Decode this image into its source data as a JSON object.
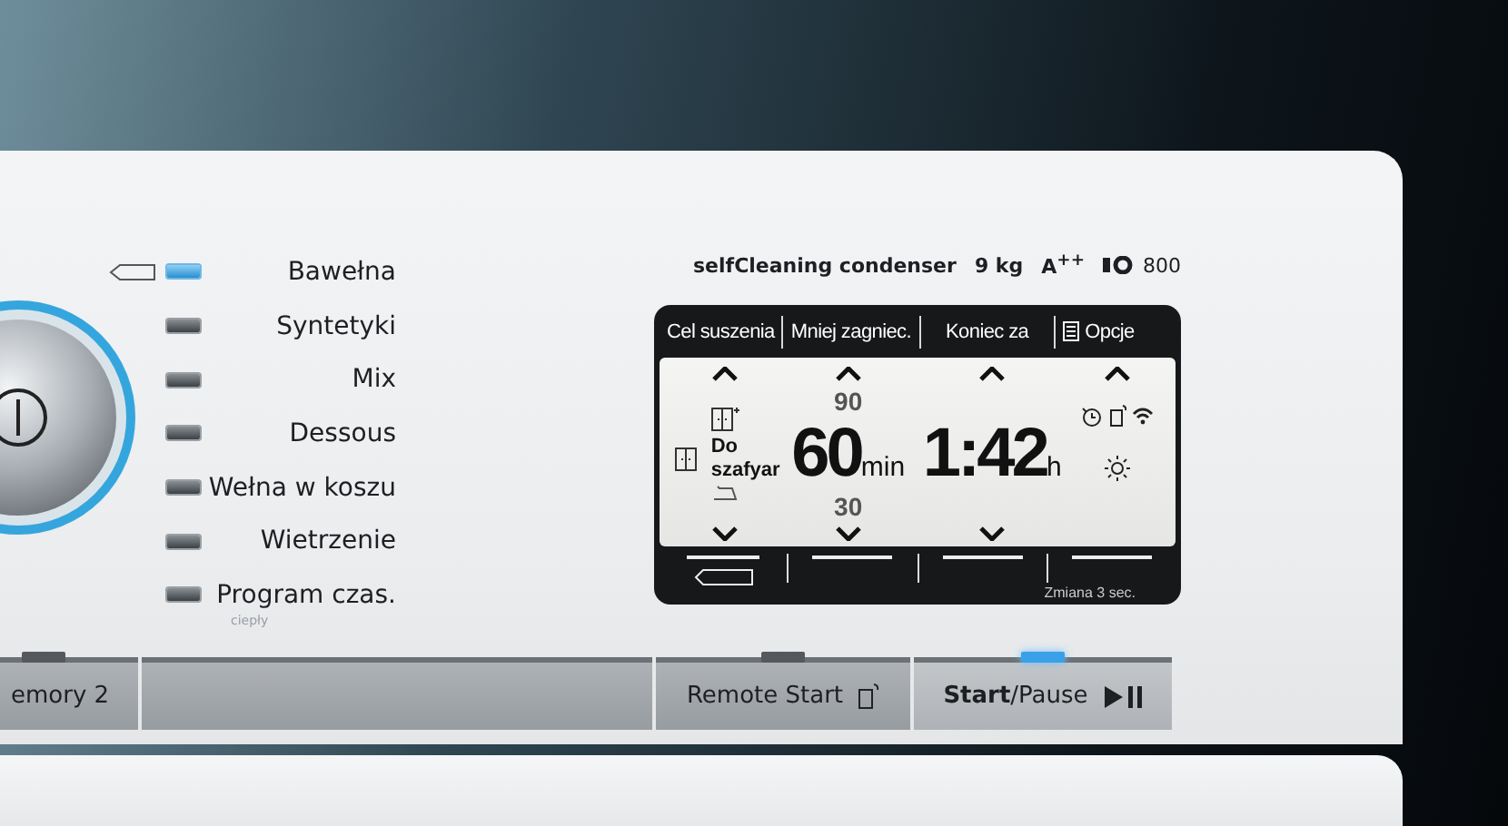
{
  "programs": [
    {
      "label": "Bawełna",
      "selected": true
    },
    {
      "label": "Syntetyki",
      "selected": false
    },
    {
      "label": "Mix",
      "selected": false
    },
    {
      "label": "Dessous",
      "selected": false
    },
    {
      "label": "Wełna w koszu",
      "selected": false
    },
    {
      "label": "Wietrzenie",
      "selected": false
    },
    {
      "label": "Program czas.",
      "selected": false,
      "note": "ciepły"
    }
  ],
  "brand": {
    "model": "selfCleaning condenser",
    "capacity": "9 kg",
    "energy_class": "A$^{++}$",
    "series": "800"
  },
  "display": {
    "tabs": [
      "Cel suszenia",
      "Mniej zagniec.",
      "Koniec za",
      "Opcje"
    ],
    "drying_target": "Do szafyar",
    "duration": {
      "upper": "90",
      "value": "60",
      "unit": "min",
      "lower": "30"
    },
    "end_time": {
      "value": "1:42",
      "unit": "h"
    },
    "footer_hint": "Zmiana 3 sec."
  },
  "buttons": [
    {
      "kind": "text",
      "label": "emory 2",
      "lit": false
    },
    {
      "kind": "blank"
    },
    {
      "kind": "remote",
      "label": "Remote Start",
      "lit": false
    },
    {
      "kind": "start",
      "label": "**Start**/Pause",
      "lit": true
    }
  ]
}
